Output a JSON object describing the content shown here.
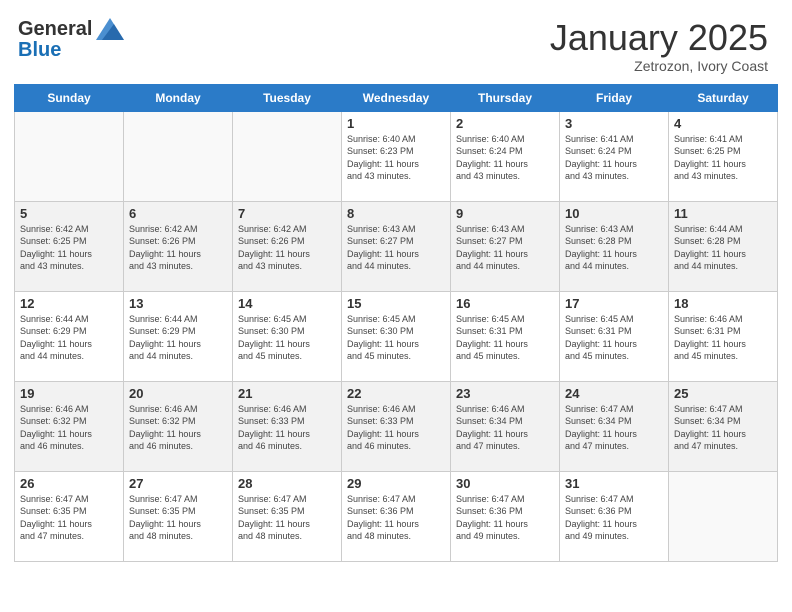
{
  "header": {
    "logo_general": "General",
    "logo_blue": "Blue",
    "title": "January 2025",
    "subtitle": "Zetrozon, Ivory Coast"
  },
  "days_of_week": [
    "Sunday",
    "Monday",
    "Tuesday",
    "Wednesday",
    "Thursday",
    "Friday",
    "Saturday"
  ],
  "weeks": [
    [
      {
        "day": "",
        "info": ""
      },
      {
        "day": "",
        "info": ""
      },
      {
        "day": "",
        "info": ""
      },
      {
        "day": "1",
        "info": "Sunrise: 6:40 AM\nSunset: 6:23 PM\nDaylight: 11 hours\nand 43 minutes."
      },
      {
        "day": "2",
        "info": "Sunrise: 6:40 AM\nSunset: 6:24 PM\nDaylight: 11 hours\nand 43 minutes."
      },
      {
        "day": "3",
        "info": "Sunrise: 6:41 AM\nSunset: 6:24 PM\nDaylight: 11 hours\nand 43 minutes."
      },
      {
        "day": "4",
        "info": "Sunrise: 6:41 AM\nSunset: 6:25 PM\nDaylight: 11 hours\nand 43 minutes."
      }
    ],
    [
      {
        "day": "5",
        "info": "Sunrise: 6:42 AM\nSunset: 6:25 PM\nDaylight: 11 hours\nand 43 minutes."
      },
      {
        "day": "6",
        "info": "Sunrise: 6:42 AM\nSunset: 6:26 PM\nDaylight: 11 hours\nand 43 minutes."
      },
      {
        "day": "7",
        "info": "Sunrise: 6:42 AM\nSunset: 6:26 PM\nDaylight: 11 hours\nand 43 minutes."
      },
      {
        "day": "8",
        "info": "Sunrise: 6:43 AM\nSunset: 6:27 PM\nDaylight: 11 hours\nand 44 minutes."
      },
      {
        "day": "9",
        "info": "Sunrise: 6:43 AM\nSunset: 6:27 PM\nDaylight: 11 hours\nand 44 minutes."
      },
      {
        "day": "10",
        "info": "Sunrise: 6:43 AM\nSunset: 6:28 PM\nDaylight: 11 hours\nand 44 minutes."
      },
      {
        "day": "11",
        "info": "Sunrise: 6:44 AM\nSunset: 6:28 PM\nDaylight: 11 hours\nand 44 minutes."
      }
    ],
    [
      {
        "day": "12",
        "info": "Sunrise: 6:44 AM\nSunset: 6:29 PM\nDaylight: 11 hours\nand 44 minutes."
      },
      {
        "day": "13",
        "info": "Sunrise: 6:44 AM\nSunset: 6:29 PM\nDaylight: 11 hours\nand 44 minutes."
      },
      {
        "day": "14",
        "info": "Sunrise: 6:45 AM\nSunset: 6:30 PM\nDaylight: 11 hours\nand 45 minutes."
      },
      {
        "day": "15",
        "info": "Sunrise: 6:45 AM\nSunset: 6:30 PM\nDaylight: 11 hours\nand 45 minutes."
      },
      {
        "day": "16",
        "info": "Sunrise: 6:45 AM\nSunset: 6:31 PM\nDaylight: 11 hours\nand 45 minutes."
      },
      {
        "day": "17",
        "info": "Sunrise: 6:45 AM\nSunset: 6:31 PM\nDaylight: 11 hours\nand 45 minutes."
      },
      {
        "day": "18",
        "info": "Sunrise: 6:46 AM\nSunset: 6:31 PM\nDaylight: 11 hours\nand 45 minutes."
      }
    ],
    [
      {
        "day": "19",
        "info": "Sunrise: 6:46 AM\nSunset: 6:32 PM\nDaylight: 11 hours\nand 46 minutes."
      },
      {
        "day": "20",
        "info": "Sunrise: 6:46 AM\nSunset: 6:32 PM\nDaylight: 11 hours\nand 46 minutes."
      },
      {
        "day": "21",
        "info": "Sunrise: 6:46 AM\nSunset: 6:33 PM\nDaylight: 11 hours\nand 46 minutes."
      },
      {
        "day": "22",
        "info": "Sunrise: 6:46 AM\nSunset: 6:33 PM\nDaylight: 11 hours\nand 46 minutes."
      },
      {
        "day": "23",
        "info": "Sunrise: 6:46 AM\nSunset: 6:34 PM\nDaylight: 11 hours\nand 47 minutes."
      },
      {
        "day": "24",
        "info": "Sunrise: 6:47 AM\nSunset: 6:34 PM\nDaylight: 11 hours\nand 47 minutes."
      },
      {
        "day": "25",
        "info": "Sunrise: 6:47 AM\nSunset: 6:34 PM\nDaylight: 11 hours\nand 47 minutes."
      }
    ],
    [
      {
        "day": "26",
        "info": "Sunrise: 6:47 AM\nSunset: 6:35 PM\nDaylight: 11 hours\nand 47 minutes."
      },
      {
        "day": "27",
        "info": "Sunrise: 6:47 AM\nSunset: 6:35 PM\nDaylight: 11 hours\nand 48 minutes."
      },
      {
        "day": "28",
        "info": "Sunrise: 6:47 AM\nSunset: 6:35 PM\nDaylight: 11 hours\nand 48 minutes."
      },
      {
        "day": "29",
        "info": "Sunrise: 6:47 AM\nSunset: 6:36 PM\nDaylight: 11 hours\nand 48 minutes."
      },
      {
        "day": "30",
        "info": "Sunrise: 6:47 AM\nSunset: 6:36 PM\nDaylight: 11 hours\nand 49 minutes."
      },
      {
        "day": "31",
        "info": "Sunrise: 6:47 AM\nSunset: 6:36 PM\nDaylight: 11 hours\nand 49 minutes."
      },
      {
        "day": "",
        "info": ""
      }
    ]
  ]
}
